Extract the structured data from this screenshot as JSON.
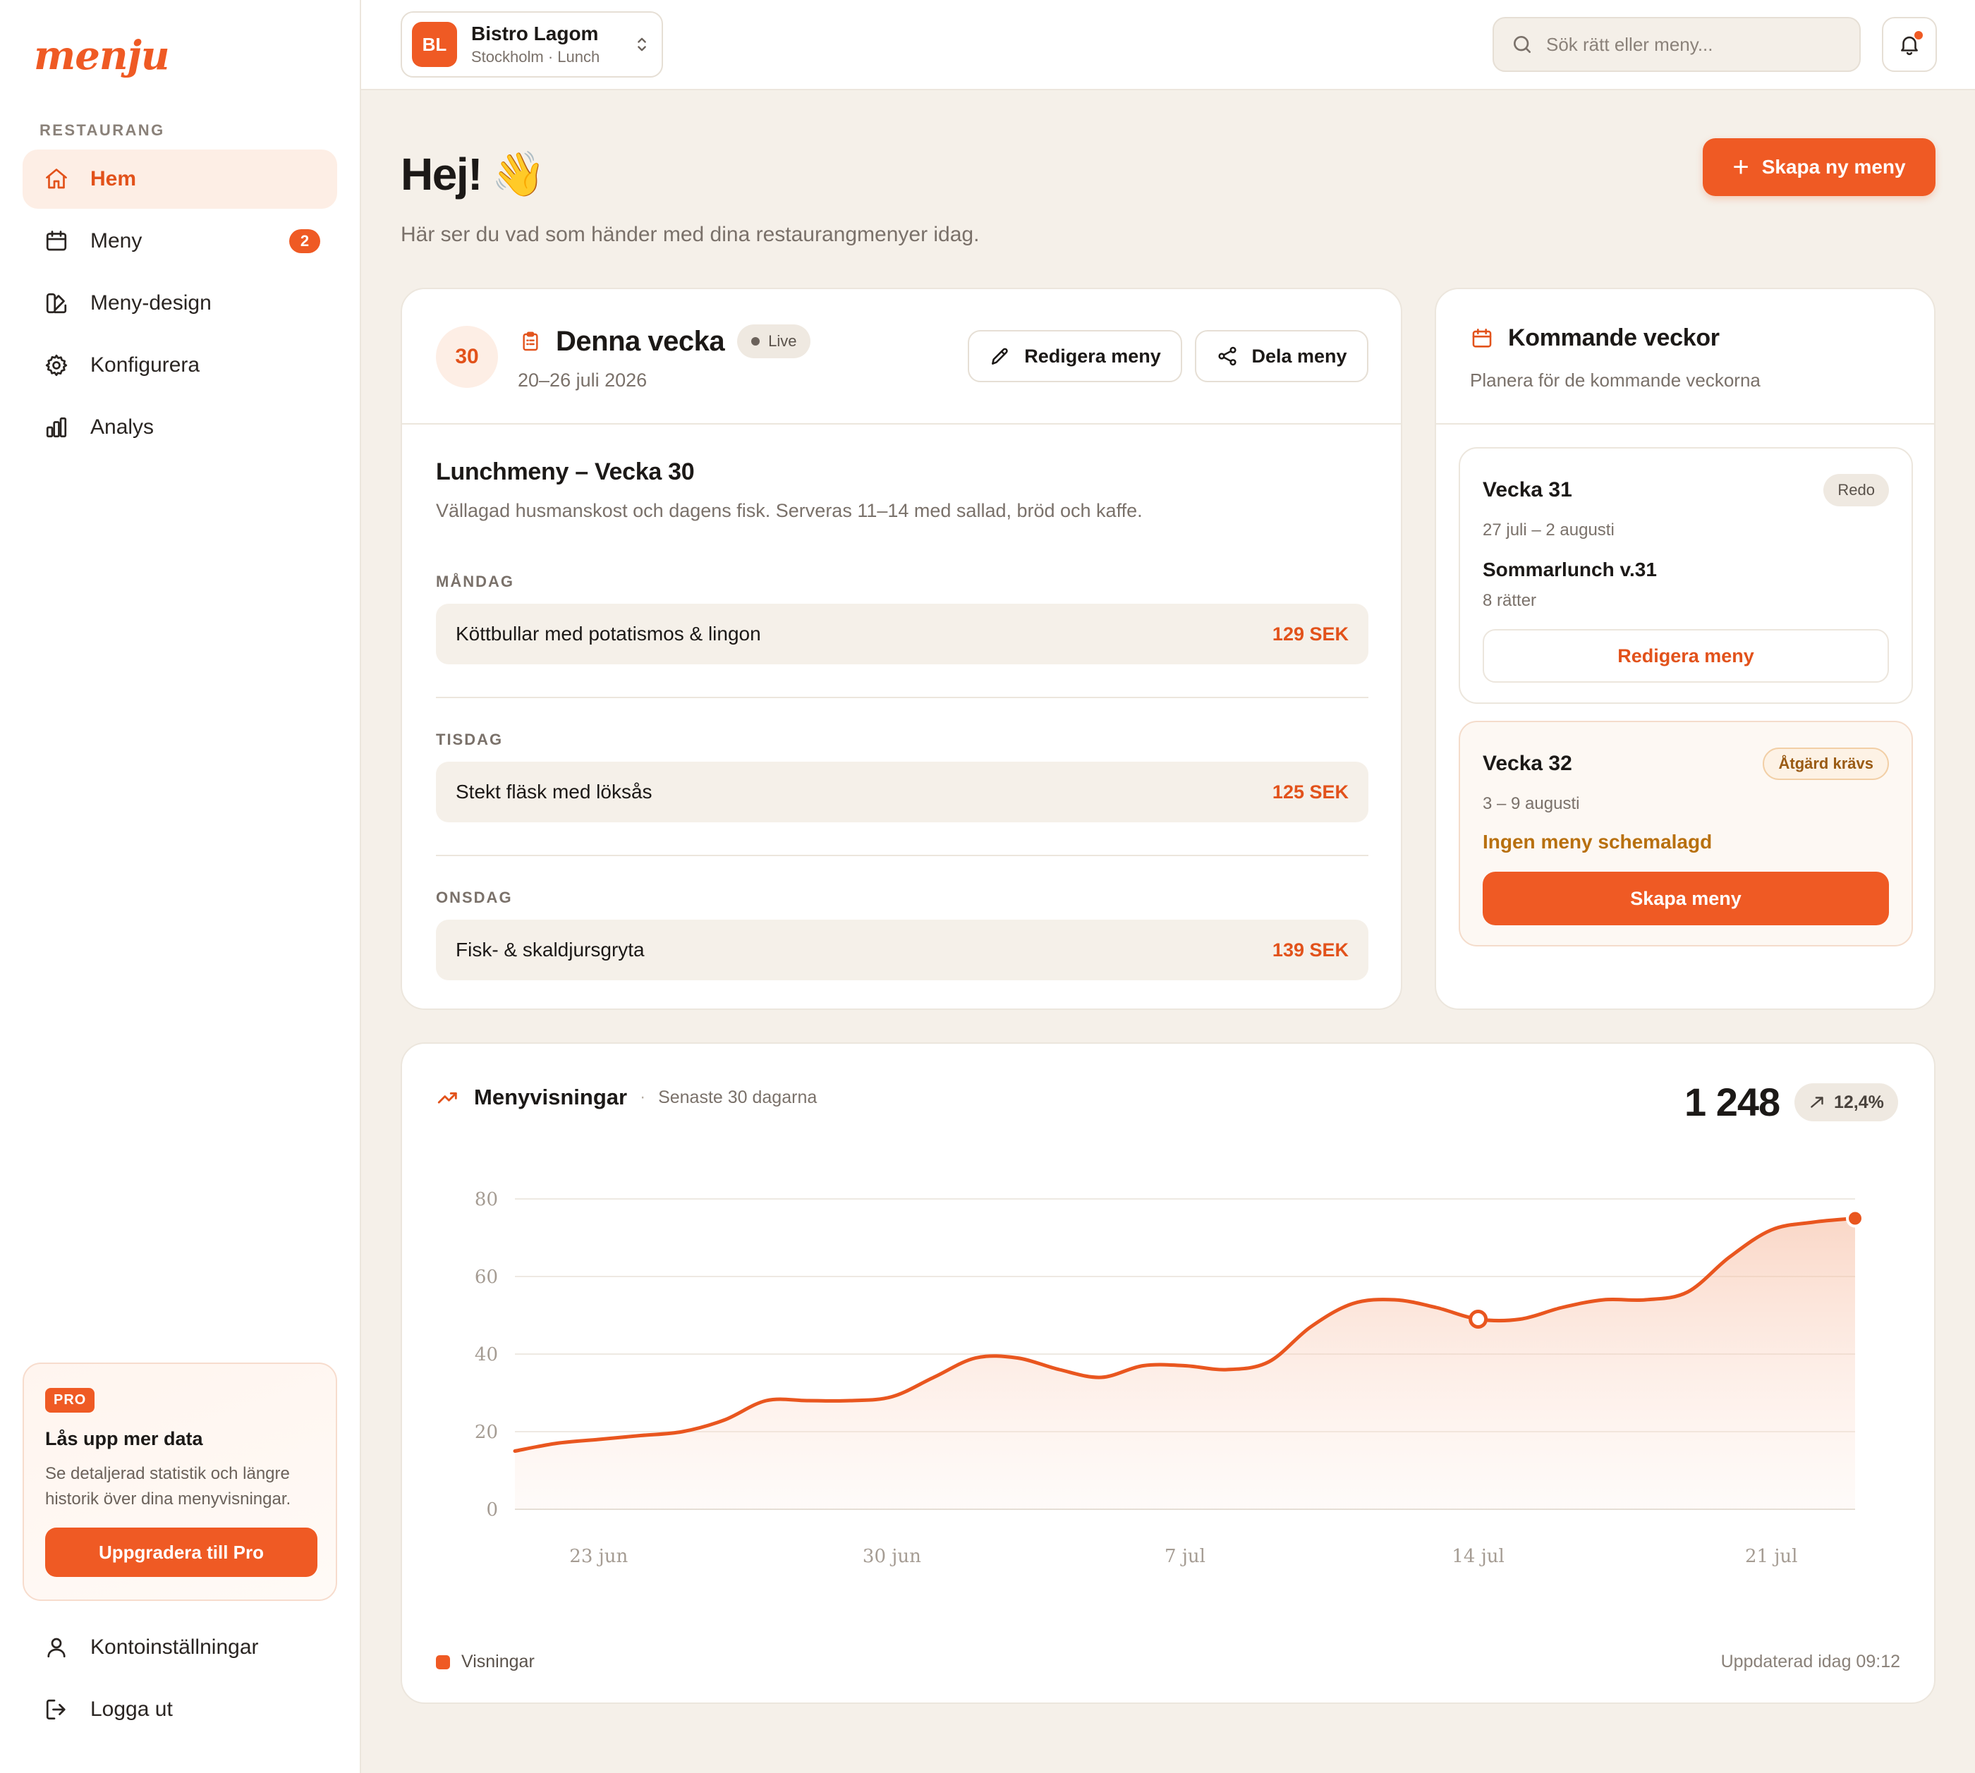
{
  "brand": {
    "logo": "menju",
    "accent": "#ef5a24"
  },
  "sidebar": {
    "section_label": "RESTAURANG",
    "items": [
      {
        "label": "Hem",
        "icon": "home-icon",
        "active": true
      },
      {
        "label": "Meny",
        "icon": "calendar-icon",
        "badge": "2"
      },
      {
        "label": "Meny-design",
        "icon": "palette-icon"
      },
      {
        "label": "Konfigurera",
        "icon": "gear-icon"
      },
      {
        "label": "Analys",
        "icon": "bar-chart-icon"
      }
    ],
    "pro": {
      "tag": "PRO",
      "title": "Lås upp mer data",
      "text": "Se detaljerad statistik och längre historik över dina menyvisningar.",
      "button": "Uppgradera till Pro"
    },
    "bottom": [
      {
        "label": "Kontoinställningar",
        "icon": "user-icon"
      },
      {
        "label": "Logga ut",
        "icon": "logout-icon"
      }
    ]
  },
  "topbar": {
    "restaurant": {
      "initials": "BL",
      "name": "Bistro Lagom",
      "sub": "Stockholm · Lunch"
    },
    "search_placeholder": "Sök rätt eller meny..."
  },
  "main": {
    "greeting": "Hej!",
    "wave": "👋",
    "subtitle": "Här ser du vad som händer med dina restaurangmenyer idag.",
    "create_button": "Skapa ny meny"
  },
  "week": {
    "number": "30",
    "title": "Denna vecka",
    "status": "Live",
    "dates": "20–26 juli 2026",
    "edit_button": "Redigera meny",
    "share_button": "Dela meny",
    "menu_title": "Lunchmeny – Vecka 30",
    "menu_desc": "Vällagad husmanskost och dagens fisk. Serveras 11–14 med sallad, bröd och kaffe.",
    "days": [
      {
        "day": "MÅNDAG",
        "dish": "Köttbullar med potatismos & lingon",
        "price": "129 SEK"
      },
      {
        "day": "TISDAG",
        "dish": "Stekt fläsk med löksås",
        "price": "125 SEK"
      },
      {
        "day": "ONSDAG",
        "dish": "Fisk- & skaldjursgryta",
        "price": "139 SEK"
      }
    ]
  },
  "upcoming": {
    "title": "Kommande veckor",
    "subtitle": "Planera för de kommande veckorna",
    "weeks": [
      {
        "title": "Vecka 31",
        "status": "Redo",
        "dates": "27 juli – 2 augusti",
        "menu": "Sommarlunch v.31",
        "count": "8 rätter",
        "button": "Redigera meny"
      },
      {
        "title": "Vecka 32",
        "status": "Åtgärd krävs",
        "dates": "3 – 9 augusti",
        "warning": "Ingen meny schemalagd",
        "button": "Skapa meny"
      }
    ]
  },
  "chart": {
    "title": "Menyvisningar",
    "range": "Senaste 30 dagarna",
    "total": "1 248",
    "trend": "12,4%",
    "legend": "Visningar",
    "updated": "Uppdaterad idag 09:12"
  },
  "chart_data": {
    "type": "area",
    "title": "Menyvisningar",
    "x": [
      "21 jun",
      "22 jun",
      "23 jun",
      "24 jun",
      "25 jun",
      "26 jun",
      "27 jun",
      "28 jun",
      "29 jun",
      "30 jun",
      "1 jul",
      "2 jul",
      "3 jul",
      "4 jul",
      "5 jul",
      "6 jul",
      "7 jul",
      "8 jul",
      "9 jul",
      "10 jul",
      "11 jul",
      "12 jul",
      "13 jul",
      "14 jul",
      "15 jul",
      "16 jul",
      "17 jul",
      "18 jul",
      "19 jul",
      "20 jul",
      "21 jul",
      "22 jul"
    ],
    "x_ticks": [
      "23 jun",
      "30 jun",
      "7 jul",
      "14 jul",
      "21 jul"
    ],
    "series": [
      {
        "name": "Visningar",
        "values": [
          15,
          17,
          18,
          19,
          20,
          23,
          28,
          28,
          28,
          29,
          34,
          39,
          39,
          36,
          34,
          37,
          37,
          36,
          38,
          47,
          53,
          54,
          52,
          49,
          49,
          52,
          54,
          54,
          56,
          65,
          72,
          74,
          75
        ]
      }
    ],
    "highlight_index": 23,
    "ylim": [
      0,
      80
    ],
    "y_ticks": [
      0,
      20,
      40,
      60,
      80
    ],
    "grid": true,
    "legend": "bottom-left"
  }
}
